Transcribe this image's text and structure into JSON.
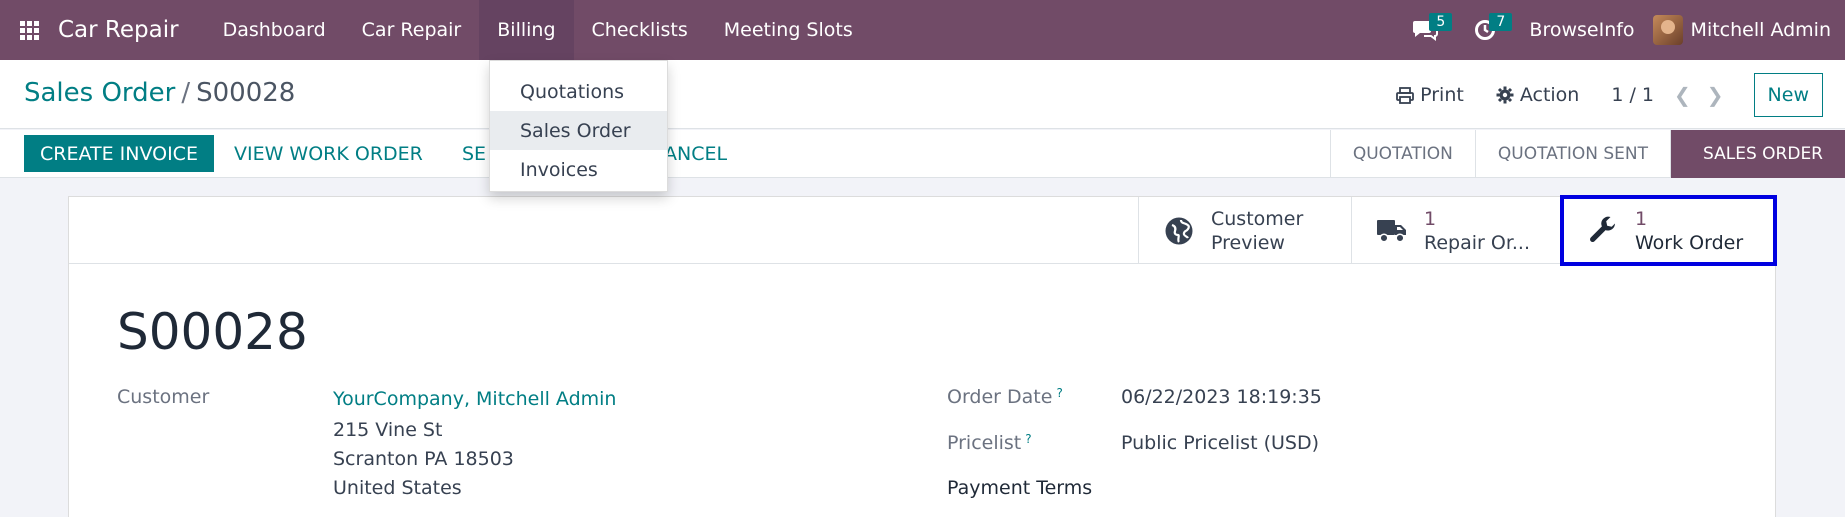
{
  "topbar": {
    "app_name": "Car Repair",
    "menu": [
      "Dashboard",
      "Car Repair",
      "Billing",
      "Checklists",
      "Meeting Slots"
    ],
    "messages_count": "5",
    "activities_count": "7",
    "company": "BrowseInfo",
    "user": "Mitchell Admin",
    "color": "#714b67"
  },
  "dropdown": {
    "items": [
      "Quotations",
      "Sales Order",
      "Invoices"
    ],
    "active": "Sales Order"
  },
  "control_panel": {
    "breadcrumb_parent": "Sales Order",
    "breadcrumb_separator": "/",
    "breadcrumb_current": "S00028",
    "print_label": "Print",
    "action_label": "Action",
    "pager": "1 / 1",
    "new_label": "New"
  },
  "statusbar": {
    "create_invoice": "CREATE INVOICE",
    "view_work_order": "VIEW WORK ORDER",
    "send_partial": "SE",
    "cancel_partial": "ANCEL",
    "stages": [
      "QUOTATION",
      "QUOTATION SENT",
      "SALES ORDER"
    ],
    "active_stage": "SALES ORDER"
  },
  "smart_buttons": {
    "customer_preview_line1": "Customer",
    "customer_preview_line2": "Preview",
    "repair_count": "1",
    "repair_label": "Repair Or...",
    "work_order_count": "1",
    "work_order_label": "Work Order"
  },
  "form": {
    "name": "S00028",
    "customer_label": "Customer",
    "customer_name": "YourCompany, Mitchell Admin",
    "address_line1": "215 Vine St",
    "address_line2": "Scranton PA 18503",
    "address_line3": "United States",
    "order_date_label": "Order Date",
    "order_date": "06/22/2023 18:19:35",
    "pricelist_label": "Pricelist",
    "pricelist": "Public Pricelist (USD)",
    "payment_terms_label": "Payment Terms",
    "help_mark": "?"
  }
}
